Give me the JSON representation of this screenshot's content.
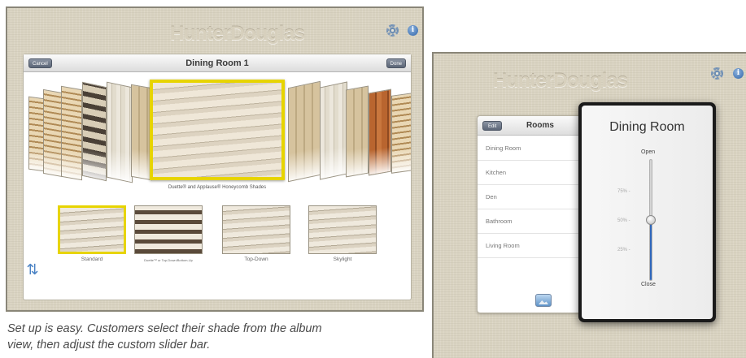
{
  "left_screen": {
    "brand": "HunterDouglas",
    "navbar": {
      "cancel_label": "Cancel",
      "title": "Dining Room 1",
      "done_label": "Done"
    },
    "featured_caption": "Duette® and Applause® Honeycomb Shades",
    "thumbnails": [
      {
        "label": "Standard",
        "selected": true
      },
      {
        "label": "Duette™ or Top-Down/Bottom-Up",
        "selected": false
      },
      {
        "label": "Top-Down",
        "selected": false
      },
      {
        "label": "Skylight",
        "selected": false
      }
    ],
    "icons": [
      "gear-icon",
      "info-icon",
      "refresh-icon"
    ],
    "accent_color": "#e7d400"
  },
  "caption": "Set up is easy. Customers select their shade from the album view, then adjust the custom slider bar.",
  "right_screen": {
    "brand": "HunterDouglas",
    "rooms_panel": {
      "edit_label": "Edit",
      "title": "Rooms",
      "items": [
        "Dining Room",
        "Kitchen",
        "Den",
        "Bathroom",
        "Living Room"
      ]
    },
    "slider_modal": {
      "title": "Dining Room",
      "open_label": "Open",
      "close_label": "Close",
      "ticks": [
        "75% -",
        "50% -",
        "25% -"
      ],
      "value_percent": 50
    },
    "icons": [
      "gear-icon",
      "info-icon",
      "photo-icon"
    ],
    "slider_color": "#2f68bd"
  }
}
